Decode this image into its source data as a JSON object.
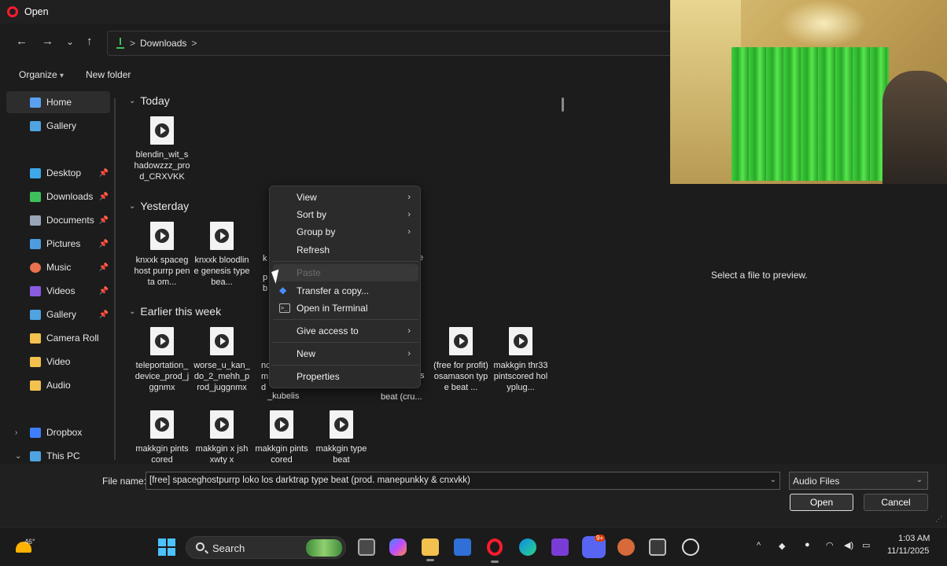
{
  "window": {
    "title": "Open",
    "close": "✕"
  },
  "nav": {
    "back": "←",
    "forward": "→",
    "recent": "⌄",
    "up": "↑"
  },
  "address": {
    "crumbs": [
      "Downloads"
    ],
    "sep": ">"
  },
  "commands": {
    "organize": "Organize",
    "organize_caret": "▾",
    "new_folder": "New folder"
  },
  "sidebar": {
    "items": [
      {
        "label": "Home",
        "icon": "home-icon",
        "color": "#5aa0f0"
      },
      {
        "label": "Gallery",
        "icon": "gallery-icon",
        "color": "#4fa3e0"
      },
      {
        "label": "Desktop",
        "icon": "desktop-icon",
        "color": "#3fa8e8",
        "pinned": true
      },
      {
        "label": "Downloads",
        "icon": "downloads-icon",
        "color": "#3fbf5a",
        "pinned": true
      },
      {
        "label": "Documents",
        "icon": "documents-icon",
        "color": "#9aa6b8",
        "pinned": true
      },
      {
        "label": "Pictures",
        "icon": "pictures-icon",
        "color": "#4f9be0",
        "pinned": true
      },
      {
        "label": "Music",
        "icon": "music-icon",
        "color": "#e8714f",
        "pinned": true
      },
      {
        "label": "Videos",
        "icon": "videos-icon",
        "color": "#8a5be0",
        "pinned": true
      },
      {
        "label": "Gallery",
        "icon": "gallery-icon",
        "color": "#4fa3e0",
        "pinned": true
      },
      {
        "label": "Camera Roll",
        "icon": "folder-icon",
        "color": "#f2c14e"
      },
      {
        "label": "Video",
        "icon": "folder-icon",
        "color": "#f2c14e"
      },
      {
        "label": "Audio",
        "icon": "folder-icon",
        "color": "#f2c14e"
      },
      {
        "label": "Dropbox",
        "icon": "dropbox-icon",
        "color": "#3d7fff",
        "expander": "›"
      },
      {
        "label": "This PC",
        "icon": "pc-icon",
        "color": "#4fa3e0",
        "expander": "⌄"
      }
    ],
    "pin": "📌"
  },
  "groups": {
    "today": "Today",
    "yesterday": "Yesterday",
    "earlier": "Earlier this week",
    "caret": "⌄"
  },
  "files": {
    "today": [
      "blendin_wit_shadowzzz_prod_CRXVKK"
    ],
    "yesterday": [
      "knxxk spaceghost purrp penta om...",
      "knxxk bloodline genesis type bea...",
      "k",
      "p",
      "b",
      "e"
    ],
    "earlier": [
      "teleportation_device_prod_jggnmx",
      "worse_u_kan_do_2_mehh_prod_juggnmx",
      "nc",
      "m",
      "d",
      "_kubelis",
      "s",
      "beat (cru...",
      "(free for profit) osamason type beat ...",
      "makkgin thr33 pintscored holyplug..."
    ],
    "more": [
      "makkgin pintscored",
      "makkgin x jshxwty x",
      "makkgin pintscored",
      "makkgin type beat"
    ]
  },
  "context_menu": {
    "items": [
      {
        "label": "View",
        "submenu": true
      },
      {
        "label": "Sort by",
        "submenu": true
      },
      {
        "label": "Group by",
        "submenu": true
      },
      {
        "label": "Refresh"
      },
      {
        "label": "Paste",
        "disabled": true
      },
      {
        "label": "Transfer a copy...",
        "icon": "dropbox-icon"
      },
      {
        "label": "Open in Terminal",
        "icon": "terminal-icon"
      },
      {
        "label": "Give access to",
        "submenu": true
      },
      {
        "label": "New",
        "submenu": true
      },
      {
        "label": "Properties"
      }
    ],
    "arrow": "›"
  },
  "preview": {
    "text": "Select a file to preview."
  },
  "bottom": {
    "file_name_label": "File name:",
    "file_name_value": "[free] spaceghostpurrp  loko los  darktrap type beat (prod. manepunkky & cnxvkk)",
    "file_type": "Audio Files",
    "open": "Open",
    "cancel": "Cancel",
    "dropdown": "⌄"
  },
  "taskbar": {
    "temperature": "46°",
    "search_placeholder": "Search",
    "time": "1:03 AM",
    "date": "11/11/2025",
    "badge": "9+",
    "tray_chevron": "^"
  },
  "colors": {
    "accent": "#4cc2ff",
    "opera": "#ff1b2d",
    "downloads_green": "#3fbf5a"
  }
}
